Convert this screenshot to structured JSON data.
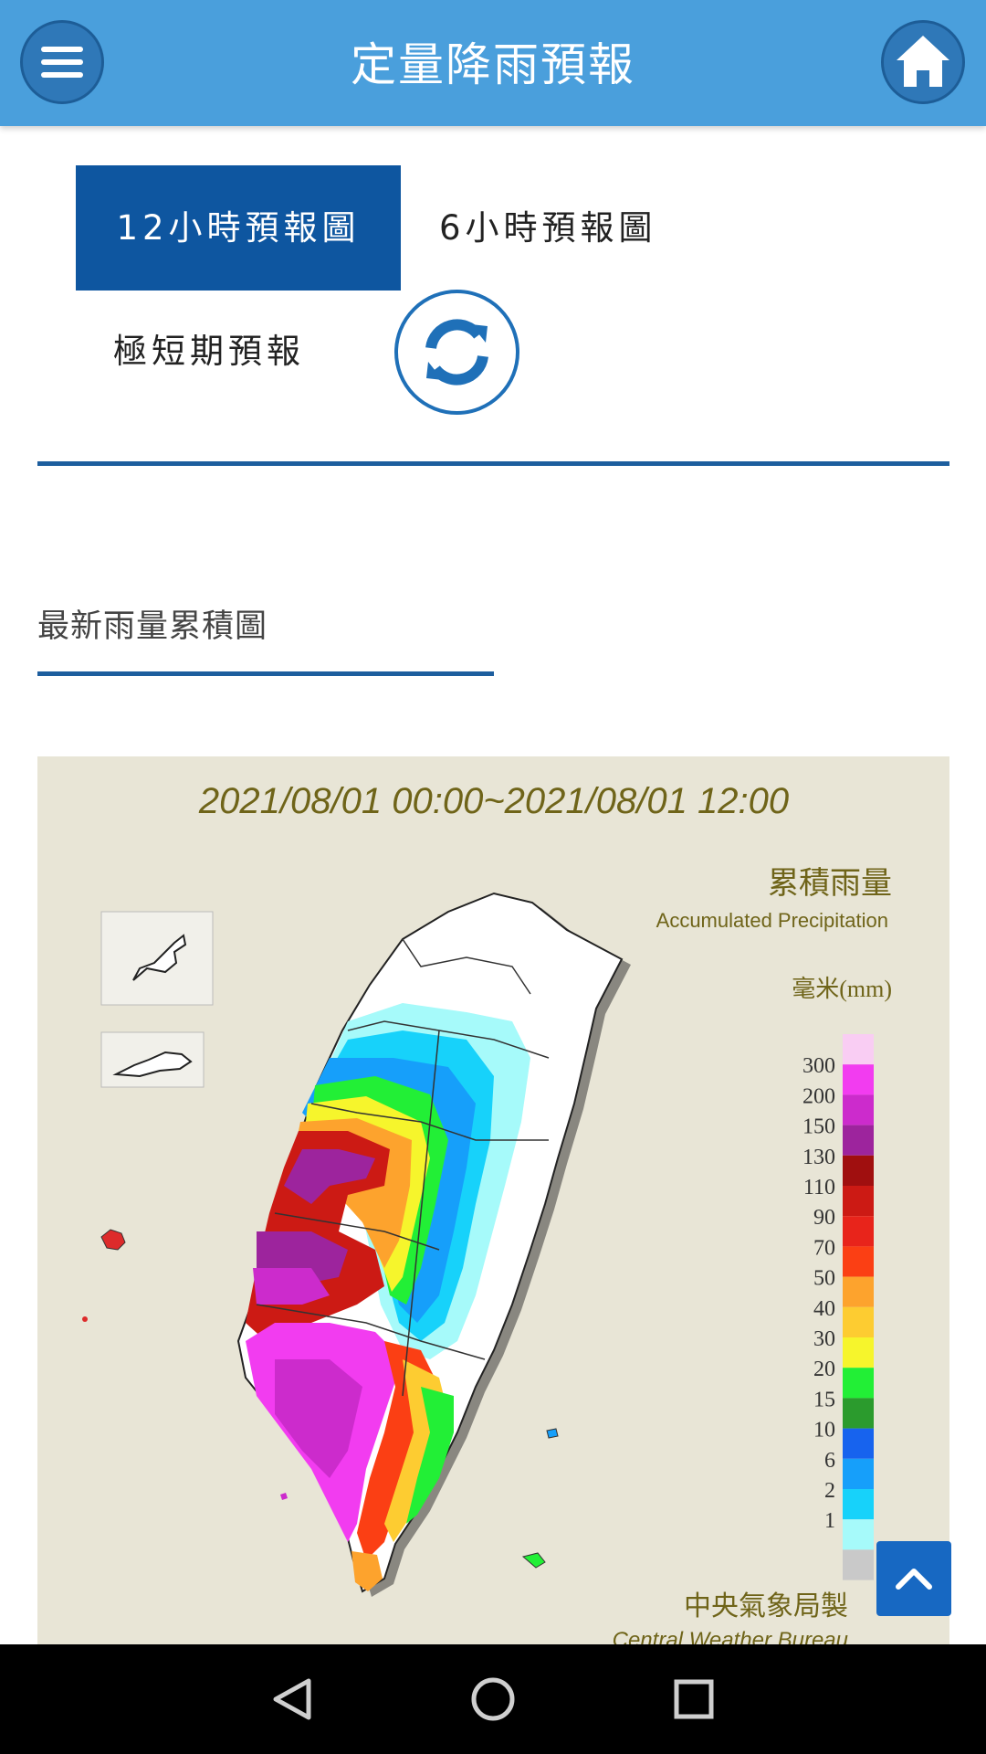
{
  "header": {
    "title": "定量降雨預報",
    "menu_icon": "hamburger-menu-icon",
    "home_icon": "home-icon"
  },
  "tabs": [
    {
      "label": "12小時預報圖",
      "active": true
    },
    {
      "label": "6小時預報圖",
      "active": false
    },
    {
      "label": "極短期預報",
      "active": false
    }
  ],
  "refresh_icon": "refresh-icon",
  "section": {
    "title": "最新雨量累積圖"
  },
  "map": {
    "time_range": "2021/08/01 00:00~2021/08/01 12:00",
    "legend_title_zh": "累積雨量",
    "legend_title_en": "Accumulated Precipitation",
    "unit": "毫米(mm)",
    "legend": [
      {
        "label": "",
        "color": "#f9cdf3"
      },
      {
        "label": "300",
        "color": "#f23cf0"
      },
      {
        "label": "200",
        "color": "#cc2bcc"
      },
      {
        "label": "150",
        "color": "#9d249d"
      },
      {
        "label": "130",
        "color": "#a00f0f"
      },
      {
        "label": "110",
        "color": "#cc1a14"
      },
      {
        "label": "90",
        "color": "#e8241b"
      },
      {
        "label": "70",
        "color": "#fb3f14"
      },
      {
        "label": "50",
        "color": "#fda32d"
      },
      {
        "label": "40",
        "color": "#fdcc31"
      },
      {
        "label": "30",
        "color": "#f6f52c"
      },
      {
        "label": "20",
        "color": "#22ef36"
      },
      {
        "label": "15",
        "color": "#2b9b2d"
      },
      {
        "label": "10",
        "color": "#1763ee"
      },
      {
        "label": "6",
        "color": "#169ffa"
      },
      {
        "label": "2",
        "color": "#17d2fa"
      },
      {
        "label": "1",
        "color": "#a6fafa"
      },
      {
        "label": "",
        "color": "#c9c9c9"
      }
    ],
    "credit_zh": "中央氣象局製",
    "credit_en": "Central Weather Bureau"
  },
  "scroll_top_icon": "chevron-up-icon",
  "system_nav": {
    "back_icon": "back-triangle-icon",
    "home_icon": "home-circle-icon",
    "recents_icon": "recents-square-icon"
  }
}
